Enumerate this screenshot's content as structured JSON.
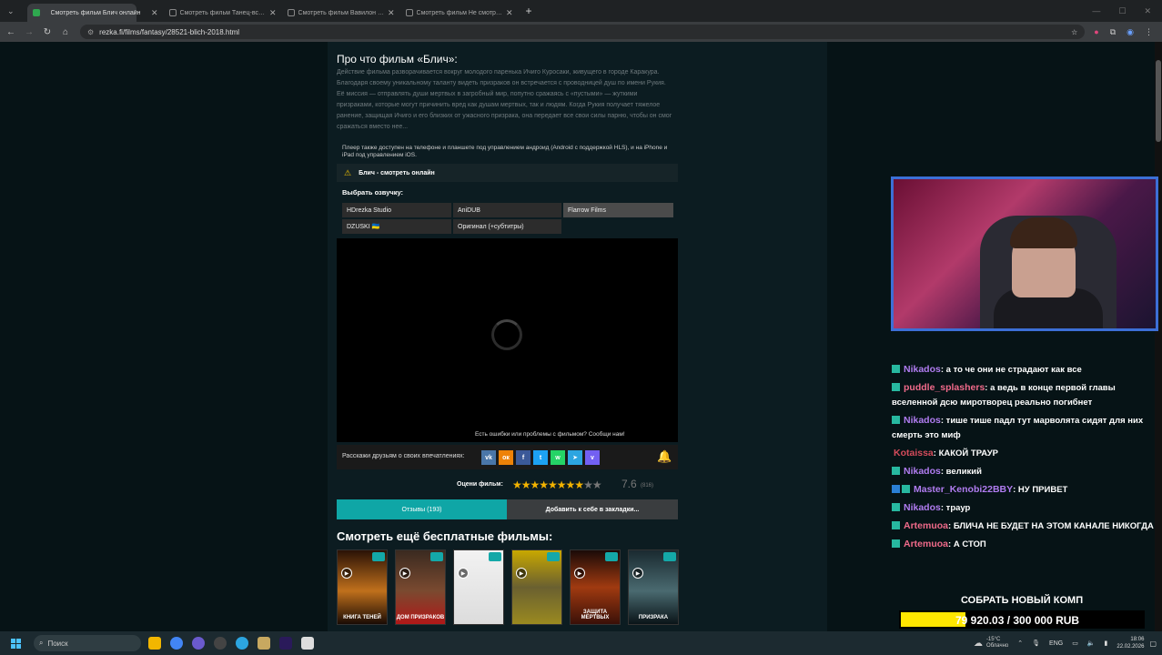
{
  "browser": {
    "tabs": [
      {
        "label": "Смотреть фильм Блич онлайн",
        "active": true
      },
      {
        "label": "Смотреть фильм Танец-вспыш",
        "active": false
      },
      {
        "label": "Смотреть фильм Вавилон онл",
        "active": false
      },
      {
        "label": "Смотреть фильм Не смотрит",
        "active": false
      }
    ],
    "url": "rezka.fi/films/fantasy/28521-blich-2018.html"
  },
  "page": {
    "plot_title": "Про что фильм «Блич»:",
    "plot_text": "Действие фильма разворачивается вокруг молодого паренька Ичиго Куросаки, живущего в городе Каракура. Благодаря своему уникальному таланту видеть призраков он встречается с проводницей душ по имени Рукия. Её миссия — отправлять души мертвых в загробный мир, попутно сражаясь с «пустыми» — жуткими призраками, которые могут причинить вред как душам мертвых, так и людям. Когда Рукия получает тяжелое ранение, защищая Ичиго и его близких от ужасного призрака, она передает все свои силы парню, чтобы он смог сражаться вместо нее...",
    "player_note": "Плеер также доступен на телефоне и планшете под управлением андроид (Android с поддержкой HLS), и на iPhone и iPad под управлением iOS.",
    "player_title": "Блич - смотреть онлайн",
    "choose_voice": "Выбрать озвучку:",
    "voices": [
      "HDrezka Studio",
      "AniDUB",
      "Flarrow Films",
      "DZUSKI 🇺🇦",
      "Оригинал (+субтитры)"
    ],
    "selected_voice": "Flarrow Films",
    "report_text": "Есть ошибки или проблемы с фильмом? Сообщи нам!",
    "share_label": "Расскажи друзьям о своих впечатлениях:",
    "rating_label": "Оцени фильм:",
    "rating_value": "7.6",
    "rating_count": "(816)",
    "rating_stars": 7.6,
    "reviews_button": "Отзывы (193)",
    "bookmark_button": "Добавить к себе в закладки...",
    "more_title": "Смотреть ещё бесплатные фильмы:",
    "posters": [
      "КНИГА ТЕНЕЙ",
      "ДОМ ПРИЗРАКОВ",
      "",
      "",
      "ЗАЩИТА МЁРТВЫХ",
      "ПРИЗРАКА"
    ]
  },
  "stream": {
    "chat": [
      {
        "user": "Nikados",
        "color": "violet",
        "text": ": а то че они не страдают как все"
      },
      {
        "user": "puddle_splashers",
        "color": "pink",
        "text": ": а ведь в конце первой главы вселенной дсю миротворец реально погибнет"
      },
      {
        "user": "Nikados",
        "color": "violet",
        "text": ": тише тише падл тут марволята сидят для них смерть это миф"
      },
      {
        "user": "Kotaissa",
        "color": "red",
        "text": ": КАКОЙ ТРАУР"
      },
      {
        "user": "Nikados",
        "color": "violet",
        "text": ": великий"
      },
      {
        "user": "Master_Kenobi22BBY",
        "color": "violet",
        "text": ": НУ ПРИВЕТ"
      },
      {
        "user": "Nikados",
        "color": "violet",
        "text": ": траур"
      },
      {
        "user": "Artemuoa",
        "color": "pink",
        "text": ": БЛИЧА НЕ БУДЕТ НА ЭТОМ КАНАЛЕ НИКОГДА"
      },
      {
        "user": "Artemuoa",
        "color": "pink",
        "text": ": А СТОП"
      }
    ],
    "goal_title": "СОБРАТЬ НОВЫЙ КОМП",
    "goal_progress": "79 920.03 / 300 000 RUB",
    "goal_fraction": 0.266
  },
  "taskbar": {
    "search_placeholder": "Поиск",
    "temperature": "-15°C",
    "weather": "Облачно",
    "lang": "ENG",
    "time": "18:06",
    "date": "22.02.2026"
  }
}
